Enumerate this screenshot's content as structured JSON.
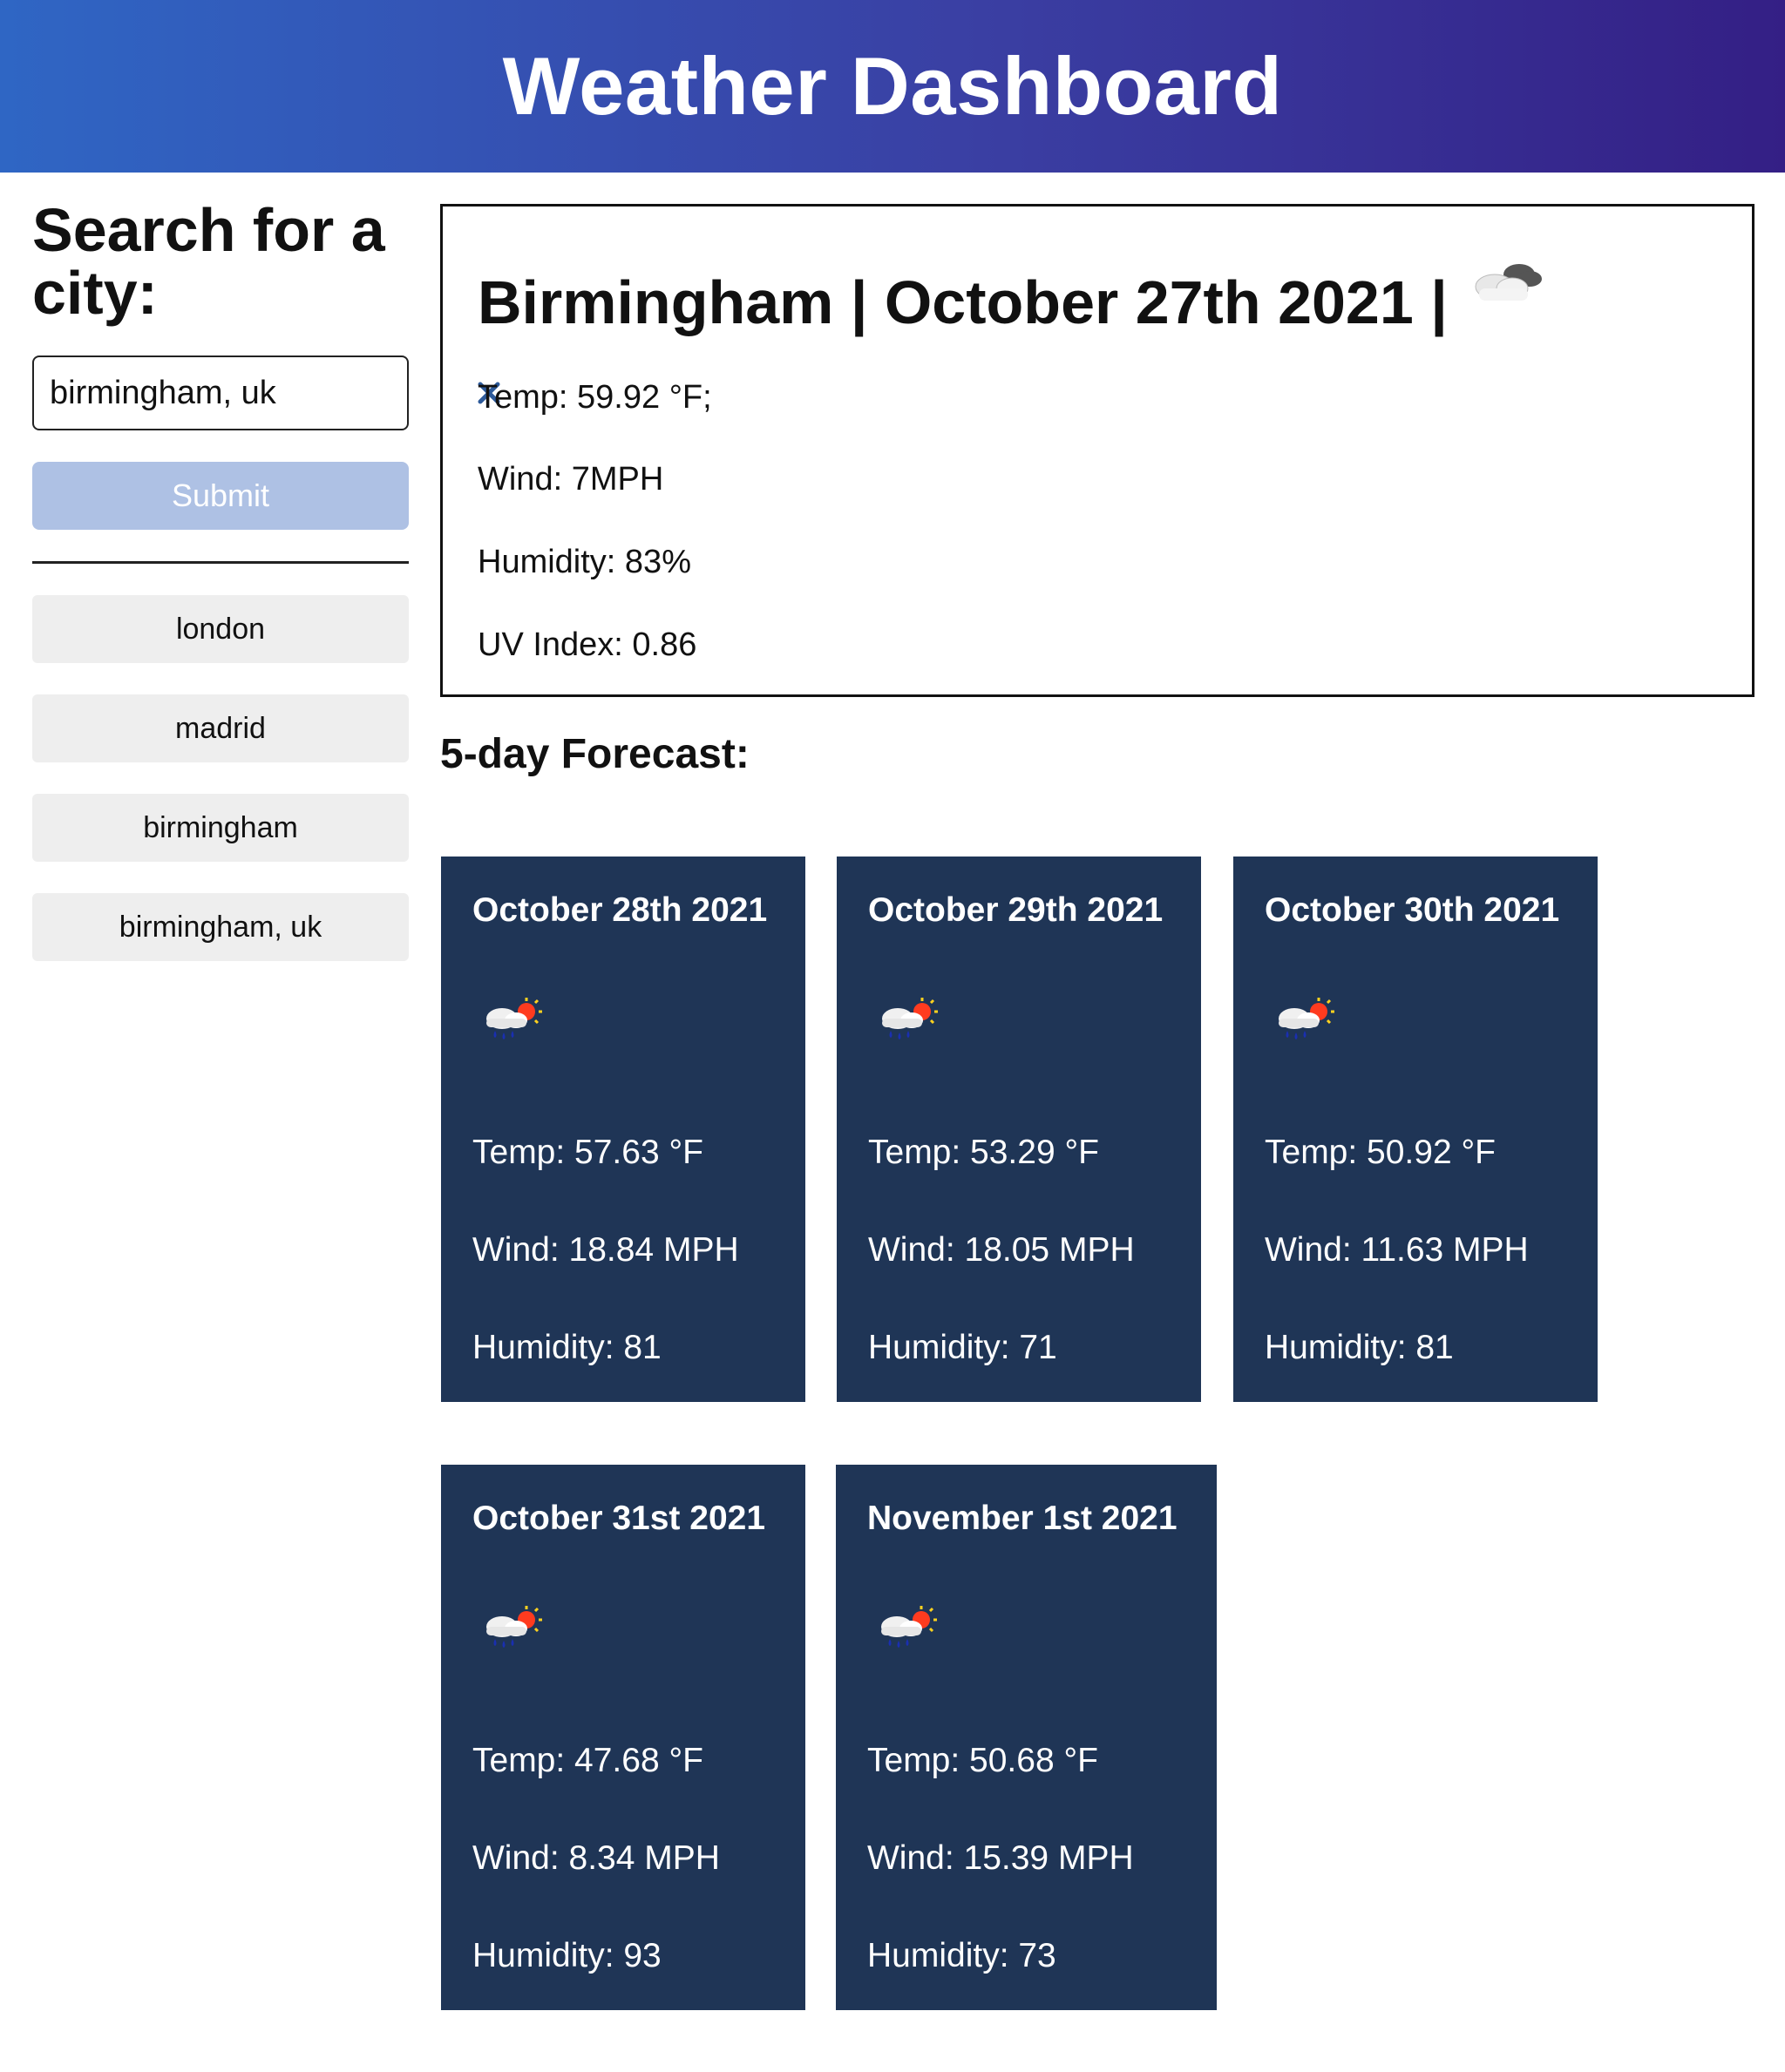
{
  "header": {
    "title": "Weather Dashboard"
  },
  "sidebar": {
    "heading": "Search for a city:",
    "search": {
      "value": "birmingham, uk",
      "placeholder": ""
    },
    "submit_label": "Submit",
    "history": [
      "london",
      "madrid",
      "birmingham",
      "birmingham, uk"
    ]
  },
  "current": {
    "title": "Birmingham | October 27th 2021 |",
    "icon": "cloudy-icon",
    "temp": "Temp: 59.92 °F;",
    "wind": "Wind: 7MPH",
    "humidity": "Humidity: 83%",
    "uv": "UV Index: 0.86"
  },
  "forecast": {
    "heading": "5-day Forecast:",
    "days": [
      {
        "date": "October 28th 2021",
        "icon": "rain-sun-icon",
        "temp": "Temp: 57.63 °F",
        "wind": "Wind: 18.84 MPH",
        "humidity": "Humidity: 81"
      },
      {
        "date": "October 29th 2021",
        "icon": "rain-sun-icon",
        "temp": "Temp: 53.29 °F",
        "wind": "Wind: 18.05 MPH",
        "humidity": "Humidity: 71"
      },
      {
        "date": "October 30th 2021",
        "icon": "rain-sun-icon",
        "temp": "Temp: 50.92 °F",
        "wind": "Wind: 11.63 MPH",
        "humidity": "Humidity: 81"
      },
      {
        "date": "October 31st 2021",
        "icon": "rain-sun-icon",
        "temp": "Temp: 47.68 °F",
        "wind": "Wind: 8.34 MPH",
        "humidity": "Humidity: 93"
      },
      {
        "date": "November 1st 2021",
        "icon": "rain-sun-icon",
        "temp": "Temp: 50.68 °F",
        "wind": "Wind: 15.39 MPH",
        "humidity": "Humidity: 73"
      }
    ]
  },
  "colors": {
    "header_start": "#2f66c4",
    "header_end": "#341f85",
    "card_bg": "#1f3556",
    "submit_bg": "#aec1e4",
    "history_bg": "#eeeeee"
  }
}
